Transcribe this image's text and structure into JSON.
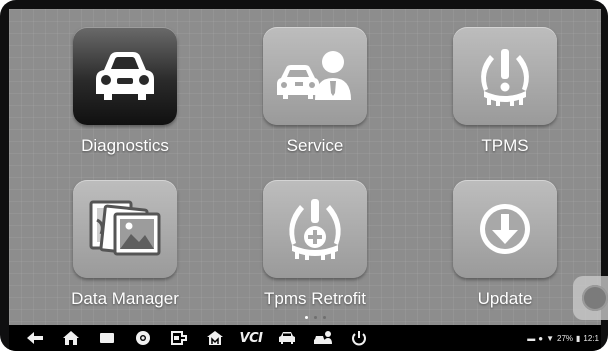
{
  "apps": [
    {
      "id": "diagnostics",
      "label": "Diagnostics",
      "icon": "car-front-icon"
    },
    {
      "id": "service",
      "label": "Service",
      "icon": "car-technician-icon"
    },
    {
      "id": "tpms",
      "label": "TPMS",
      "icon": "tpms-warning-icon"
    },
    {
      "id": "data-manager",
      "label": "Data Manager",
      "icon": "photo-stack-icon"
    },
    {
      "id": "tpms-retrofit",
      "label": "Tpms Retrofit",
      "icon": "tpms-retrofit-icon"
    },
    {
      "id": "update",
      "label": "Update",
      "icon": "download-arrow-icon"
    }
  ],
  "pager": {
    "pages": 3,
    "active": 1
  },
  "navbar": {
    "vci_label": "VCI",
    "buttons": [
      "back-icon",
      "home-icon",
      "recent-apps-icon",
      "browser-icon",
      "connector-icon",
      "autel-home-icon",
      "vci-icon",
      "car-icon",
      "car-person-icon",
      "power-icon"
    ]
  },
  "status_bar": {
    "battery": "27%",
    "time": "12:1"
  },
  "colors": {
    "screen_bg": "#8d8d8d",
    "tile_light": "#b0b0b0",
    "tile_dark": "#1a1a1a",
    "bezel": "#0f0f10"
  }
}
